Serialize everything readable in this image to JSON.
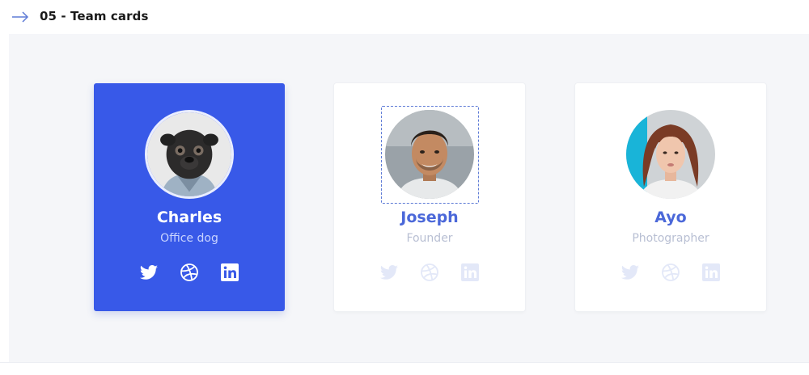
{
  "header": {
    "title": "05 - Team cards",
    "arrow_icon": "arrow-right-icon"
  },
  "team": [
    {
      "name": "Charles",
      "role": "Office dog",
      "active": true
    },
    {
      "name": "Joseph",
      "role": "Founder",
      "selected": true
    },
    {
      "name": "Ayo",
      "role": "Photographer"
    }
  ],
  "social_icons": [
    "twitter-icon",
    "dribbble-icon",
    "linkedin-icon"
  ],
  "colors": {
    "accent": "#3859e8",
    "name_text": "#4b68d9",
    "muted_text": "#b8bfd3",
    "muted_icons": "#e3e8f8",
    "stage_bg": "#f5f6f9"
  }
}
